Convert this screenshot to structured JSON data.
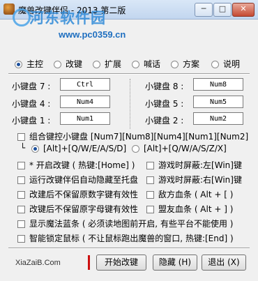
{
  "window": {
    "title": "魔兽改键伴侣 - 2013 第二版",
    "minimize_label": "─",
    "maximize_label": "□",
    "close_label": "✕"
  },
  "watermark": {
    "site_name": "河东软件园",
    "url": "www.pc0359.cn"
  },
  "tabs": [
    {
      "label": "主控",
      "selected": true
    },
    {
      "label": "改键",
      "selected": false
    },
    {
      "label": "扩展",
      "selected": false
    },
    {
      "label": "喊话",
      "selected": false
    },
    {
      "label": "方案",
      "selected": false
    },
    {
      "label": "说明",
      "selected": false
    }
  ],
  "keypad": [
    {
      "label": "小键盘 7 :",
      "value": "Ctrl"
    },
    {
      "label": "小键盘 8 :",
      "value": "Num8"
    },
    {
      "label": "小键盘 4 :",
      "value": "Num4"
    },
    {
      "label": "小键盘 5 :",
      "value": "Num5"
    },
    {
      "label": "小键盘 1 :",
      "value": "Num1"
    },
    {
      "label": "小键盘 2 :",
      "value": "Num2"
    }
  ],
  "combo": {
    "label": "组合键控小键盘 [Num7][Num8][Num4][Num1][Num2]",
    "prefix": "└",
    "option_a": "[Alt]+[Q/W/E/A/S/D]",
    "option_b": "[Alt]+[Q/W/A/S/Z/X]"
  },
  "options": [
    "* 开启改键 ( 热键:[Home] )",
    "游戏时屏蔽:左[Win]键",
    "运行改键伴侣自动隐藏至托盘",
    "游戏时屏蔽:右[Win]键",
    "改建后不保留原数字键有效性",
    "敌方血条 ( Alt + [ )",
    "改键后不保留原字母键有效性",
    "盟友血条 ( Alt + ] )",
    "显示魔法蓝条 ( 必须读地图前开启, 有些平台不能使用 )",
    "智能锁定鼠标 ( 不让鼠标跑出魔兽的窗口, 热键:[End] )"
  ],
  "footer": {
    "site": "XiaZaiB.Com",
    "start_label": "开始改键",
    "hide_label": "隐藏 (H)",
    "exit_label": "退出 (X)"
  }
}
